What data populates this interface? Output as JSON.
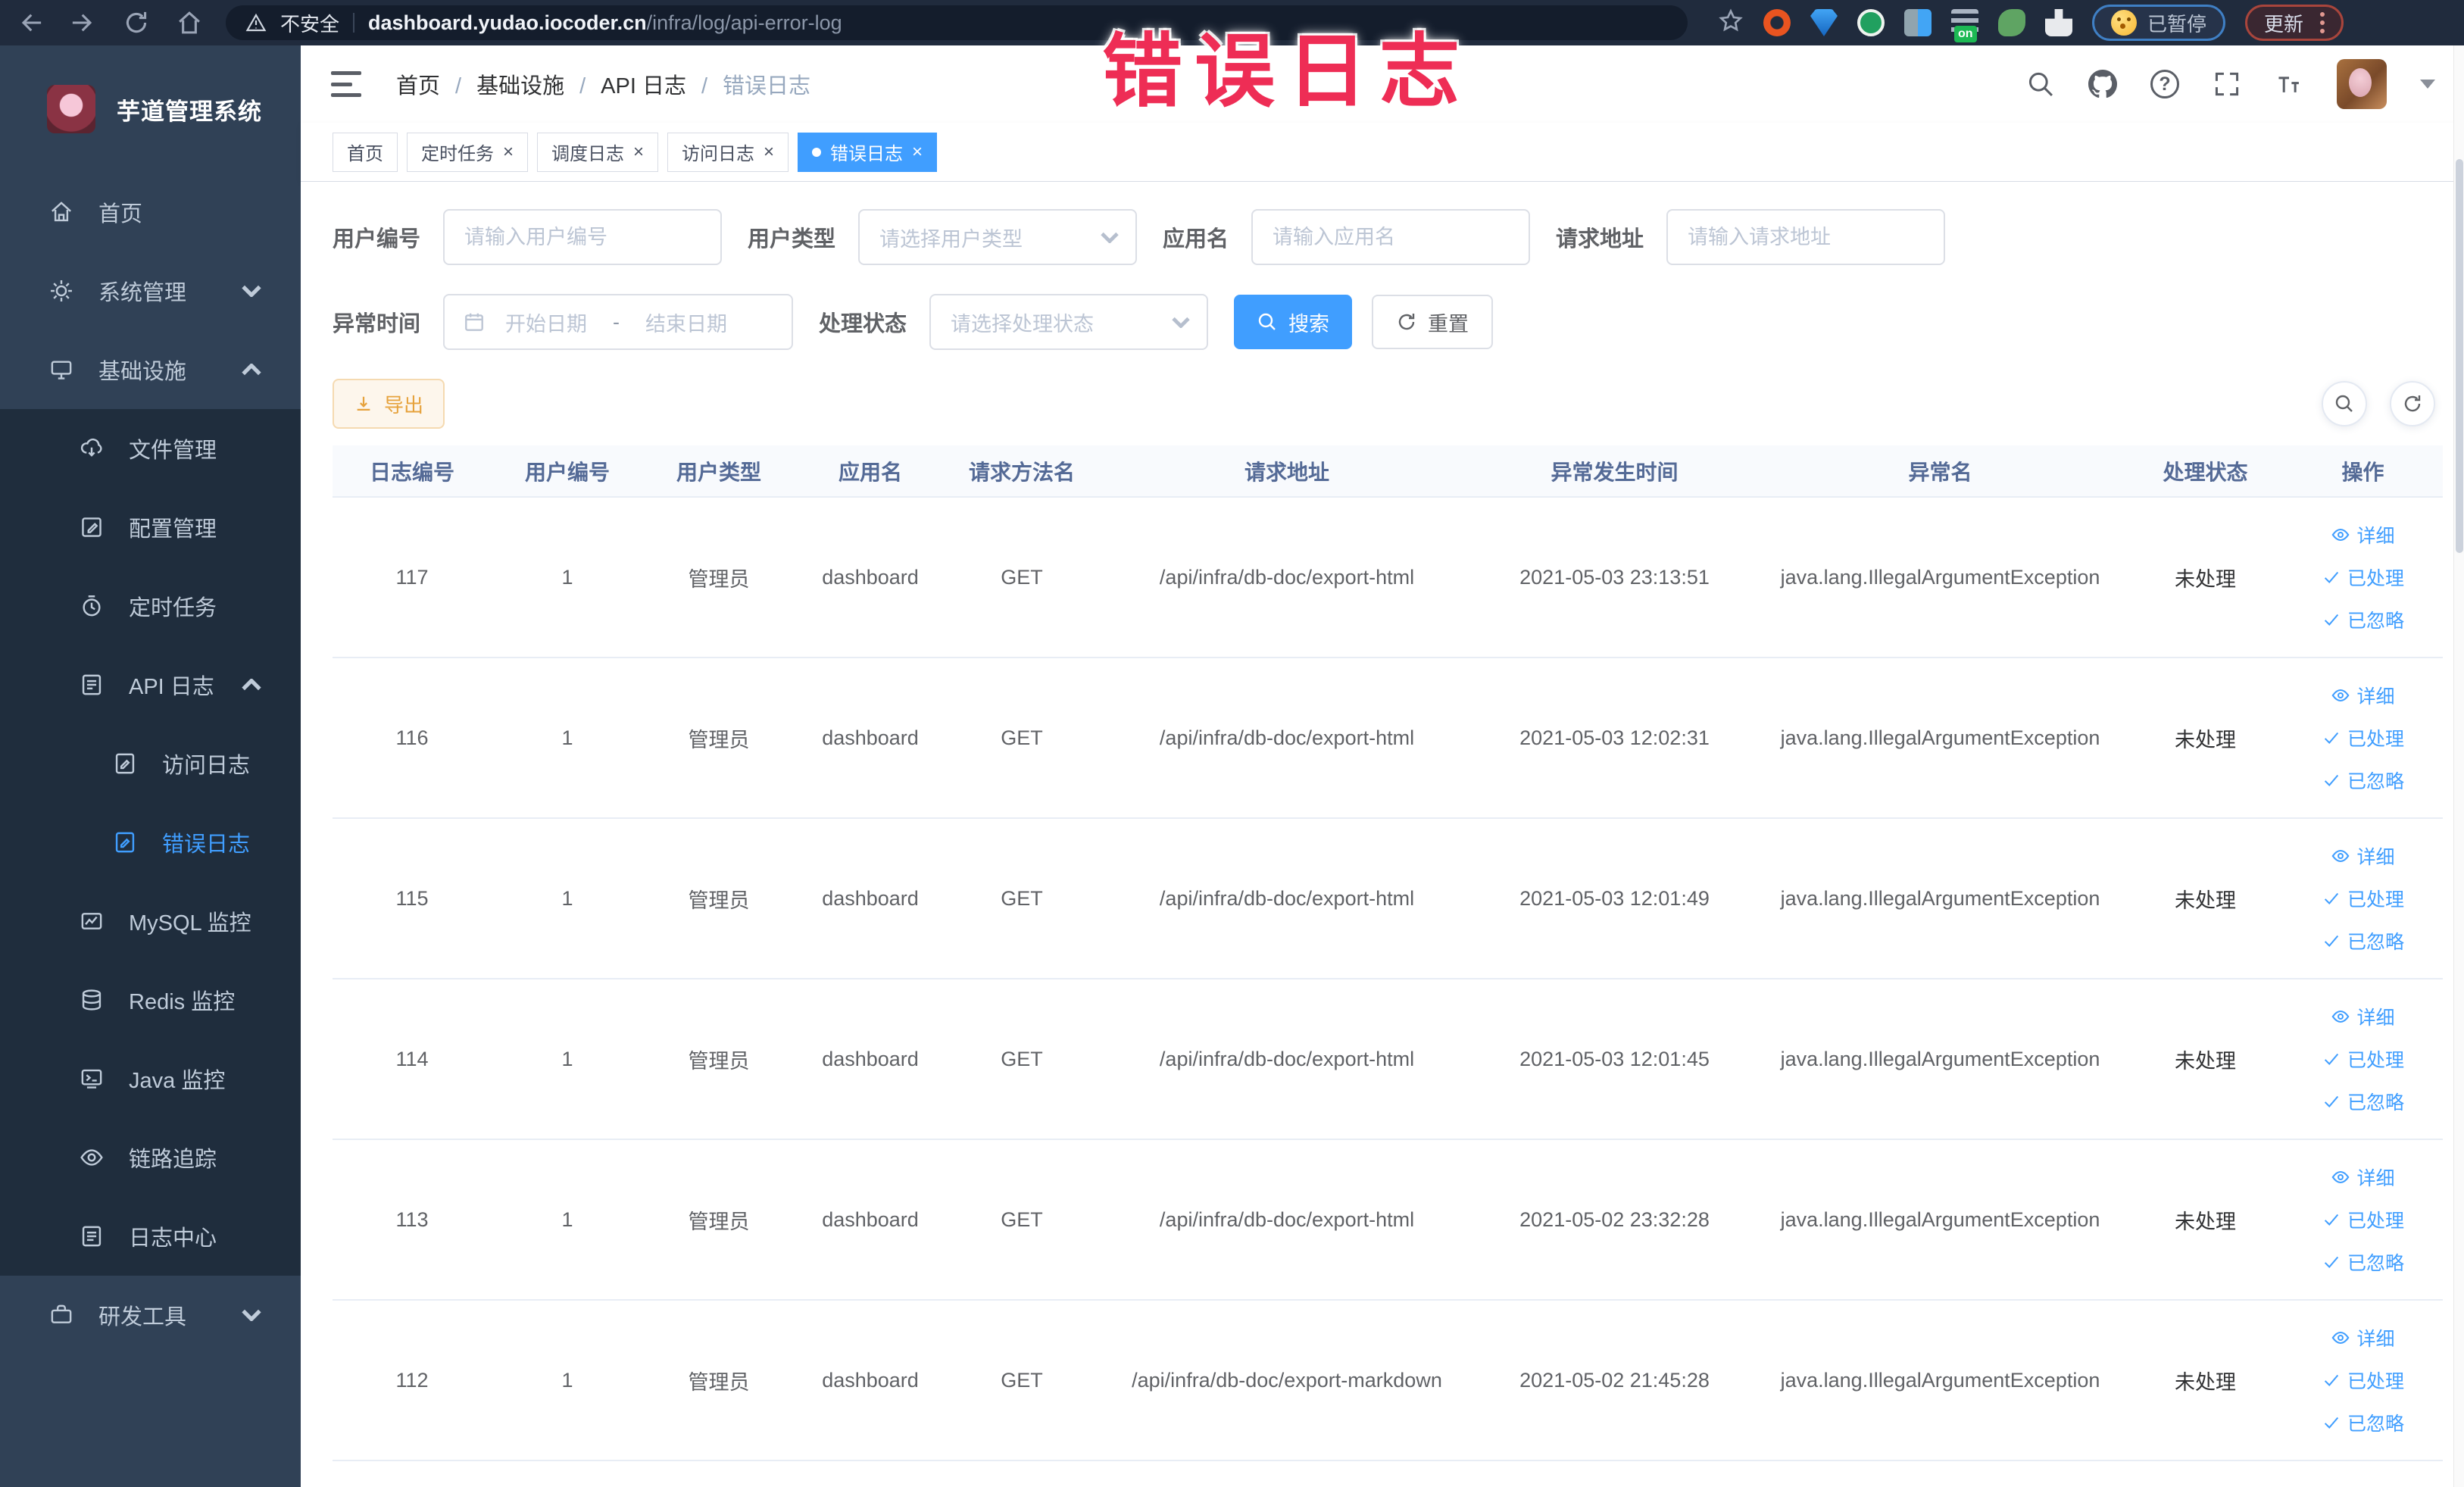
{
  "browser": {
    "security_label": "不安全",
    "url_host": "dashboard.yudao.iocoder.cn",
    "url_path": "/infra/log/api-error-log",
    "extension_badge": "on",
    "paused_pill": "已暂停",
    "update_pill": "更新"
  },
  "annotation": {
    "text": "错误日志"
  },
  "sidebar": {
    "title": "芋道管理系统",
    "items": [
      {
        "label": "首页"
      },
      {
        "label": "系统管理"
      },
      {
        "label": "基础设施"
      },
      {
        "label": "文件管理"
      },
      {
        "label": "配置管理"
      },
      {
        "label": "定时任务"
      },
      {
        "label": "API 日志"
      },
      {
        "label": "访问日志"
      },
      {
        "label": "错误日志"
      },
      {
        "label": "MySQL 监控"
      },
      {
        "label": "Redis 监控"
      },
      {
        "label": "Java 监控"
      },
      {
        "label": "链路追踪"
      },
      {
        "label": "日志中心"
      },
      {
        "label": "研发工具"
      }
    ]
  },
  "breadcrumb": {
    "items": [
      "首页",
      "基础设施",
      "API 日志",
      "错误日志"
    ]
  },
  "tabs": [
    {
      "label": "首页",
      "pinned": true
    },
    {
      "label": "定时任务"
    },
    {
      "label": "调度日志"
    },
    {
      "label": "访问日志"
    },
    {
      "label": "错误日志",
      "active": true
    }
  ],
  "filters": {
    "user_id_label": "用户编号",
    "user_id_placeholder": "请输入用户编号",
    "user_type_label": "用户类型",
    "user_type_placeholder": "请选择用户类型",
    "app_name_label": "应用名",
    "app_name_placeholder": "请输入应用名",
    "request_url_label": "请求地址",
    "request_url_placeholder": "请输入请求地址",
    "time_label": "异常时间",
    "time_start_placeholder": "开始日期",
    "time_separator": "-",
    "time_end_placeholder": "结束日期",
    "status_label": "处理状态",
    "status_placeholder": "请选择处理状态",
    "search_label": "搜索",
    "reset_label": "重置"
  },
  "toolbar": {
    "export_label": "导出"
  },
  "table": {
    "columns": [
      "日志编号",
      "用户编号",
      "用户类型",
      "应用名",
      "请求方法名",
      "请求地址",
      "异常发生时间",
      "异常名",
      "处理状态",
      "操作"
    ],
    "row_actions": {
      "detail": "详细",
      "processed": "已处理",
      "ignored": "已忽略"
    },
    "rows": [
      {
        "id": "117",
        "user_id": "1",
        "user_type": "管理员",
        "app_name": "dashboard",
        "method": "GET",
        "url": "/api/infra/db-doc/export-html",
        "time": "2021-05-03 23:13:51",
        "exception": "java.lang.IllegalArgumentException",
        "status": "未处理"
      },
      {
        "id": "116",
        "user_id": "1",
        "user_type": "管理员",
        "app_name": "dashboard",
        "method": "GET",
        "url": "/api/infra/db-doc/export-html",
        "time": "2021-05-03 12:02:31",
        "exception": "java.lang.IllegalArgumentException",
        "status": "未处理"
      },
      {
        "id": "115",
        "user_id": "1",
        "user_type": "管理员",
        "app_name": "dashboard",
        "method": "GET",
        "url": "/api/infra/db-doc/export-html",
        "time": "2021-05-03 12:01:49",
        "exception": "java.lang.IllegalArgumentException",
        "status": "未处理"
      },
      {
        "id": "114",
        "user_id": "1",
        "user_type": "管理员",
        "app_name": "dashboard",
        "method": "GET",
        "url": "/api/infra/db-doc/export-html",
        "time": "2021-05-03 12:01:45",
        "exception": "java.lang.IllegalArgumentException",
        "status": "未处理"
      },
      {
        "id": "113",
        "user_id": "1",
        "user_type": "管理员",
        "app_name": "dashboard",
        "method": "GET",
        "url": "/api/infra/db-doc/export-html",
        "time": "2021-05-02 23:32:28",
        "exception": "java.lang.IllegalArgumentException",
        "status": "未处理"
      },
      {
        "id": "112",
        "user_id": "1",
        "user_type": "管理员",
        "app_name": "dashboard",
        "method": "GET",
        "url": "/api/infra/db-doc/export-markdown",
        "time": "2021-05-02 21:45:28",
        "exception": "java.lang.IllegalArgumentException",
        "status": "未处理"
      }
    ]
  }
}
